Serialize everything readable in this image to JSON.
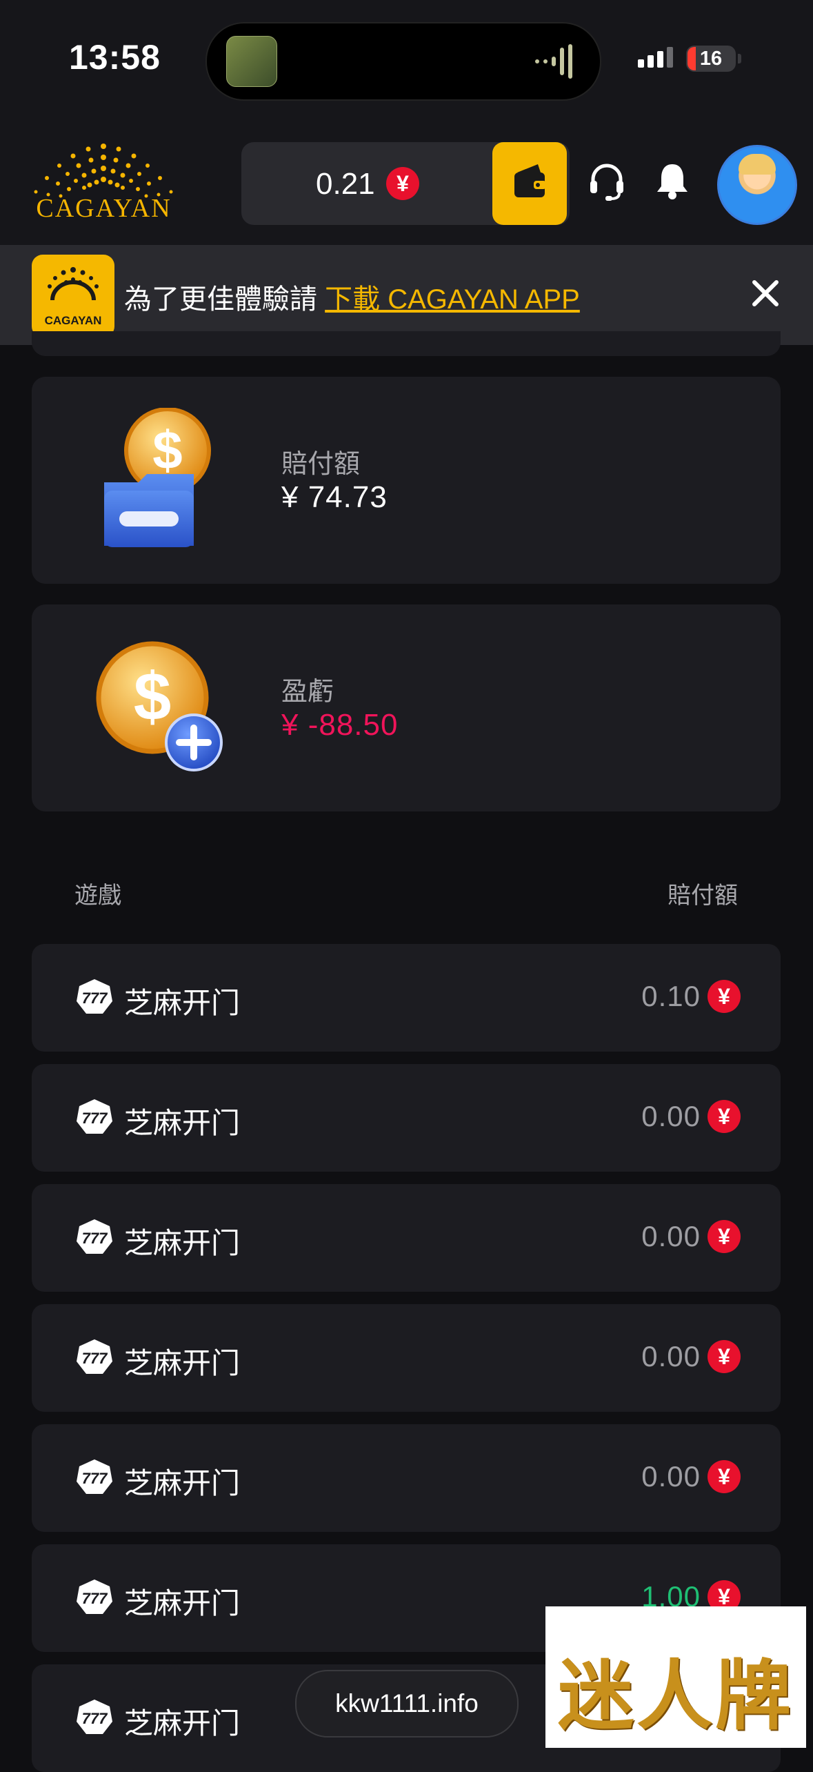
{
  "status_bar": {
    "time": "13:58",
    "battery": "16"
  },
  "header": {
    "logo_text": "CAGAYAN",
    "balance": "0.21",
    "currency_symbol": "¥"
  },
  "banner": {
    "logo_text": "CAGAYAN",
    "message": "為了更佳體驗請 ",
    "link_text": "下載 CAGAYAN APP"
  },
  "summary": {
    "payout": {
      "label": "賠付額",
      "value": "¥ 74.73"
    },
    "profit": {
      "label": "盈虧",
      "value": "¥ -88.50"
    }
  },
  "table": {
    "col_game": "遊戲",
    "col_payout": "賠付額",
    "rows": [
      {
        "game": "芝麻开门",
        "payout": "0.10"
      },
      {
        "game": "芝麻开门",
        "payout": "0.00"
      },
      {
        "game": "芝麻开门",
        "payout": "0.00"
      },
      {
        "game": "芝麻开门",
        "payout": "0.00"
      },
      {
        "game": "芝麻开门",
        "payout": "0.00"
      },
      {
        "game": "芝麻开门",
        "payout": "1.00"
      },
      {
        "game": "芝麻开门",
        "payout": ""
      }
    ]
  },
  "overlay": {
    "url": "kkw1111.info",
    "watermark": "迷人牌"
  },
  "colors": {
    "accent": "#f5b800",
    "currency_badge": "#e8112d",
    "negative": "#f0145a",
    "positive": "#1fbf74"
  }
}
